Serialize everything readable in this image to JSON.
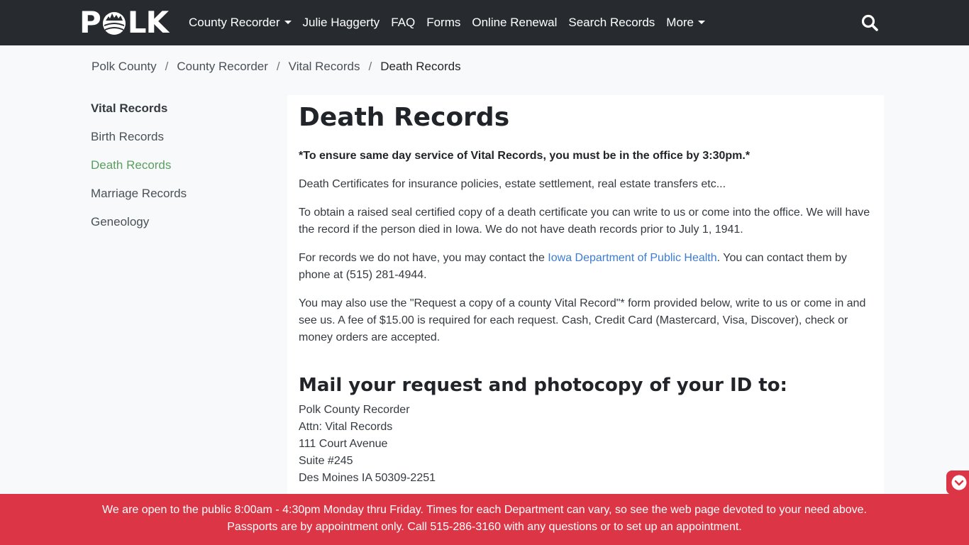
{
  "brand": {
    "logo_left": "P",
    "logo_right": "LK"
  },
  "nav": {
    "items": [
      {
        "label": "County Recorder",
        "dropdown": true
      },
      {
        "label": "Julie Haggerty",
        "dropdown": false
      },
      {
        "label": "FAQ",
        "dropdown": false
      },
      {
        "label": "Forms",
        "dropdown": false
      },
      {
        "label": "Online Renewal",
        "dropdown": false
      },
      {
        "label": "Search Records",
        "dropdown": false
      },
      {
        "label": "More",
        "dropdown": true
      }
    ],
    "search_icon": "search-icon"
  },
  "breadcrumb": {
    "items": [
      "Polk County",
      "County Recorder",
      "Vital Records",
      "Death Records"
    ],
    "separator": "/"
  },
  "sidebar": {
    "heading": "Vital Records",
    "items": [
      {
        "label": "Birth Records",
        "active": false
      },
      {
        "label": "Death Records",
        "active": true
      },
      {
        "label": "Marriage Records",
        "active": false
      },
      {
        "label": "Geneology",
        "active": false
      }
    ]
  },
  "main": {
    "title": "Death Records",
    "notice": "*To ensure same day service of Vital Records, you must be in the office by 3:30pm.*",
    "p1": "Death Certificates for insurance policies, estate settlement, real estate transfers etc...",
    "p2": "To obtain a raised seal certified copy of a death certificate you can write to us or come into the office. We will have the record if the person died in Iowa. We do not have death records prior to July 1, 1941.",
    "p3_before": "For records we do not have, you may contact the ",
    "p3_link": "Iowa Department of Public Health",
    "p3_after": ". You can contact them by phone at (515) 281-4944.",
    "p4": "You may also use the \"Request a copy of a county Vital Record\"* form provided below, write to us or come in and see us. A fee of $15.00 is required for each request. Cash, Credit Card (Mastercard, Visa, Discover), check or money orders are accepted.",
    "mail_heading": "Mail your request and photocopy of your ID to:",
    "address": [
      "Polk County Recorder",
      "Attn: Vital Records",
      "111 Court Avenue",
      "Suite #245",
      "Des Moines IA 50309-2251"
    ]
  },
  "banner": {
    "text": "We are open to the public 8:00am - 4:30pm Monday thru Friday. Times for each Department can vary, so see the web page devoted to your need above. Passports are by appointment only. Call 515-286-3160 with any questions or to set up an appointment."
  },
  "colors": {
    "navbar": "#272b30",
    "banner": "#dc3545",
    "link": "#3b7bd4",
    "sidebar_active": "#5a9e60"
  }
}
